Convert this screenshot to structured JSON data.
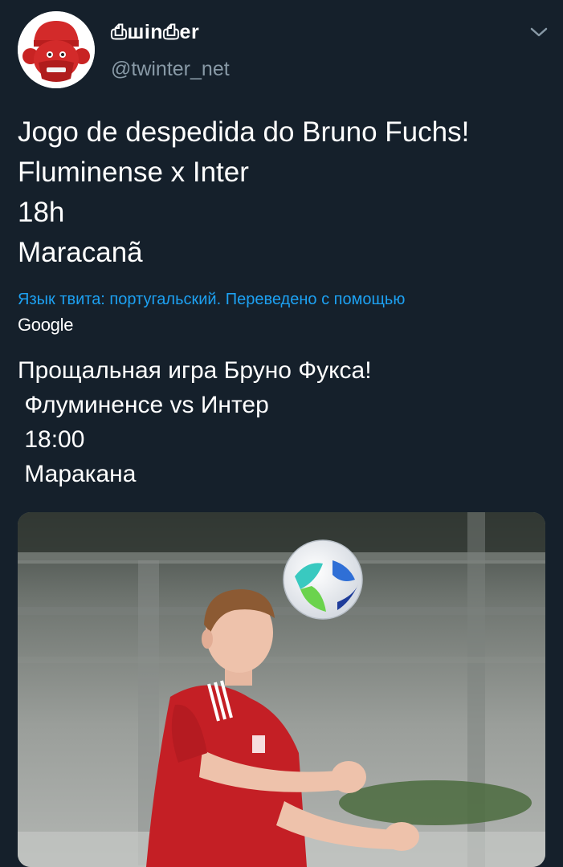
{
  "header": {
    "display_name": "⎙шin⎙er",
    "handle": "@twinter_net",
    "avatar_icon": "mascot-avatar-icon",
    "menu_icon": "chevron-down-icon"
  },
  "tweet": {
    "lines": [
      "Jogo de despedida do Bruno Fuchs!",
      "Fluminense x Inter",
      "18h",
      "Maracanã"
    ]
  },
  "translation": {
    "note": "Язык твита: португальский. Переведено с помощью",
    "provider": "Google",
    "lines": [
      "Прощальная игра Бруно Фукса!",
      " Флуминенсе vs Интер",
      " 18:00",
      " Маракана"
    ]
  },
  "media": {
    "icon": "football-player-photo"
  },
  "colors": {
    "background": "#15202b",
    "accent": "#1da1f2",
    "secondary_text": "#8899a6"
  }
}
